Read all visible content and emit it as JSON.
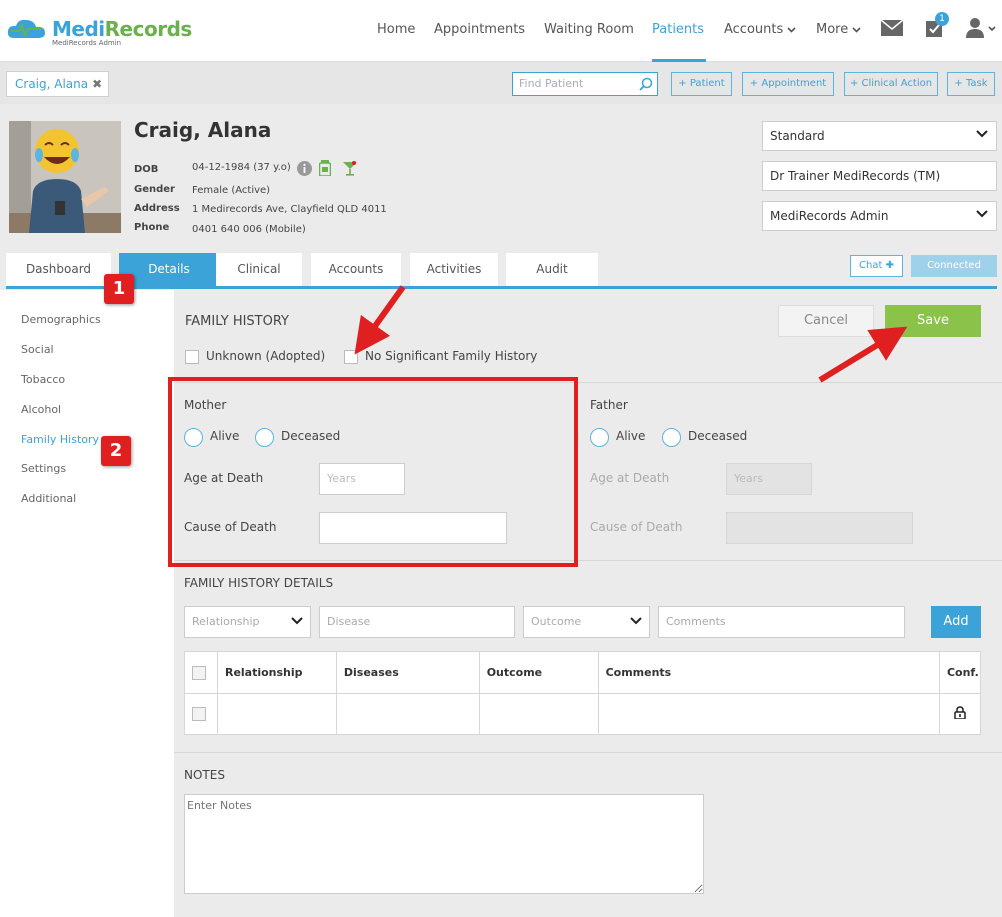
{
  "app": {
    "logo_part1": "Medi",
    "logo_part2": "Records",
    "logo_sub": "MediRecords Admin"
  },
  "nav": {
    "items": [
      "Home",
      "Appointments",
      "Waiting Room",
      "Patients",
      "Accounts",
      "More"
    ],
    "active": "Patients",
    "tasks_badge": "1"
  },
  "toolbar": {
    "patient_tab": "Craig, Alana",
    "find_placeholder": "Find Patient",
    "buttons": [
      "+ Patient",
      "+ Appointment",
      "+ Clinical Action",
      "+ Task"
    ]
  },
  "patient": {
    "name": "Craig, Alana",
    "dob_label": "DOB",
    "dob": "04-12-1984 (37 y.o)",
    "gender_label": "Gender",
    "gender": "Female (Active)",
    "address_label": "Address",
    "address": "1 Medirecords Ave, Clayfield QLD 4011",
    "phone_label": "Phone",
    "phone": "0401 640 006 (Mobile)"
  },
  "selectors": {
    "type": "Standard",
    "practitioner": "Dr Trainer MediRecords (TM)",
    "location": "MediRecords Admin"
  },
  "tabs": [
    "Dashboard",
    "Details",
    "Clinical",
    "Accounts",
    "Activities",
    "Audit"
  ],
  "active_tab": "Details",
  "chat_label": "Chat",
  "connected_label": "Connected",
  "side_menu": [
    "Demographics",
    "Social",
    "Tobacco",
    "Alcohol",
    "Family History",
    "Settings",
    "Additional"
  ],
  "active_menu": "Family History",
  "family_history": {
    "title": "FAMILY HISTORY",
    "cancel": "Cancel",
    "save": "Save",
    "unknown_label": "Unknown (Adopted)",
    "no_sig_label": "No Significant Family History",
    "mother": {
      "title": "Mother",
      "alive": "Alive",
      "deceased": "Deceased",
      "age_label": "Age at Death",
      "age_placeholder": "Years",
      "cause_label": "Cause of Death"
    },
    "father": {
      "title": "Father",
      "alive": "Alive",
      "deceased": "Deceased",
      "age_label": "Age at Death",
      "age_placeholder": "Years",
      "cause_label": "Cause of Death"
    }
  },
  "details": {
    "title": "FAMILY HISTORY DETAILS",
    "relationship_placeholder": "Relationship",
    "disease_placeholder": "Disease",
    "outcome_placeholder": "Outcome",
    "comments_placeholder": "Comments",
    "add": "Add",
    "columns": [
      "Relationship",
      "Diseases",
      "Outcome",
      "Comments",
      "Conf."
    ]
  },
  "notes": {
    "title": "NOTES",
    "placeholder": "Enter Notes"
  },
  "annotations": {
    "step1": "1",
    "step2": "2",
    "color": "#e02020"
  },
  "colors": {
    "accent": "#3ba3d8",
    "save": "#8bc34a"
  }
}
